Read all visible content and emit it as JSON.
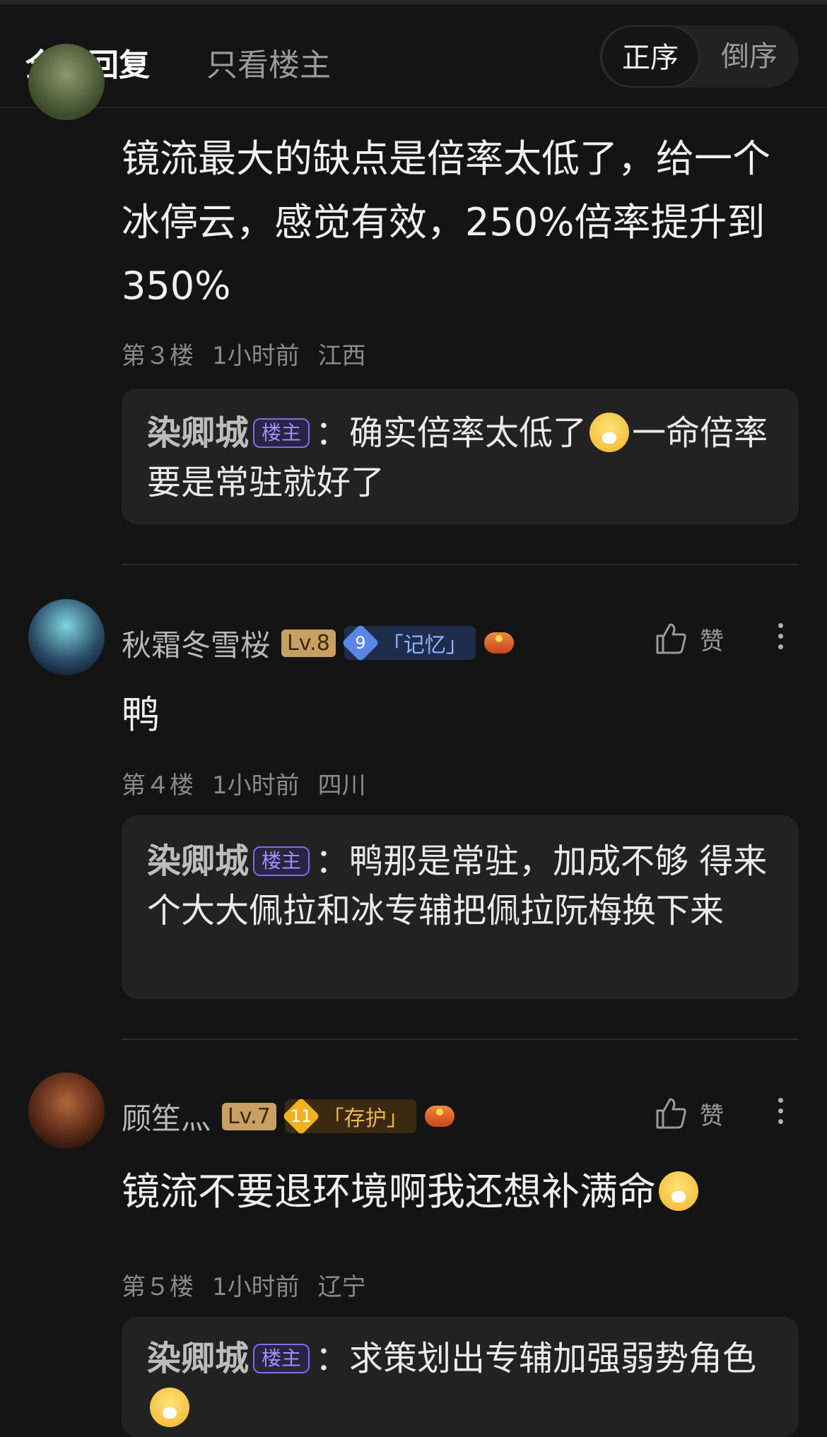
{
  "header": {
    "tab_all": "全部回复",
    "tab_op": "只看楼主",
    "sort_asc": "正序",
    "sort_desc": "倒序"
  },
  "posts": [
    {
      "content": "镜流最大的缺点是倍率太低了，给一个冰停云，感觉有效，250%倍率提升到350%",
      "floor": "第３楼",
      "time": "1小时前",
      "location": "江西",
      "reply": {
        "name": "染卿城",
        "badge": "楼主",
        "text_before": "：确实倍率太低了",
        "text_after": "一命倍率要是常驻就好了"
      }
    },
    {
      "username": "秋霜冬雪桜",
      "level": "Lv.8",
      "path_num": "9",
      "path_name": "「记忆」",
      "like_label": "赞",
      "content": "鸭",
      "floor": "第４楼",
      "time": "1小时前",
      "location": "四川",
      "reply": {
        "name": "染卿城",
        "badge": "楼主",
        "text": "：鸭那是常驻，加成不够 得来个大大佩拉和冰专辅把佩拉阮梅换下来"
      }
    },
    {
      "username": "顾笙灬",
      "level": "Lv.7",
      "path_num": "11",
      "path_name": "「存护」",
      "like_label": "赞",
      "content": "镜流不要退环境啊我还想补满命",
      "floor": "第５楼",
      "time": "1小时前",
      "location": "辽宁",
      "reply": {
        "name": "染卿城",
        "badge": "楼主",
        "text": "：求策划出专辅加强弱势角色"
      }
    }
  ],
  "colors": {
    "background": "#141414",
    "reply_box": "#222222",
    "op_badge": "#9d91ff",
    "level_badge": "#c9a063"
  }
}
